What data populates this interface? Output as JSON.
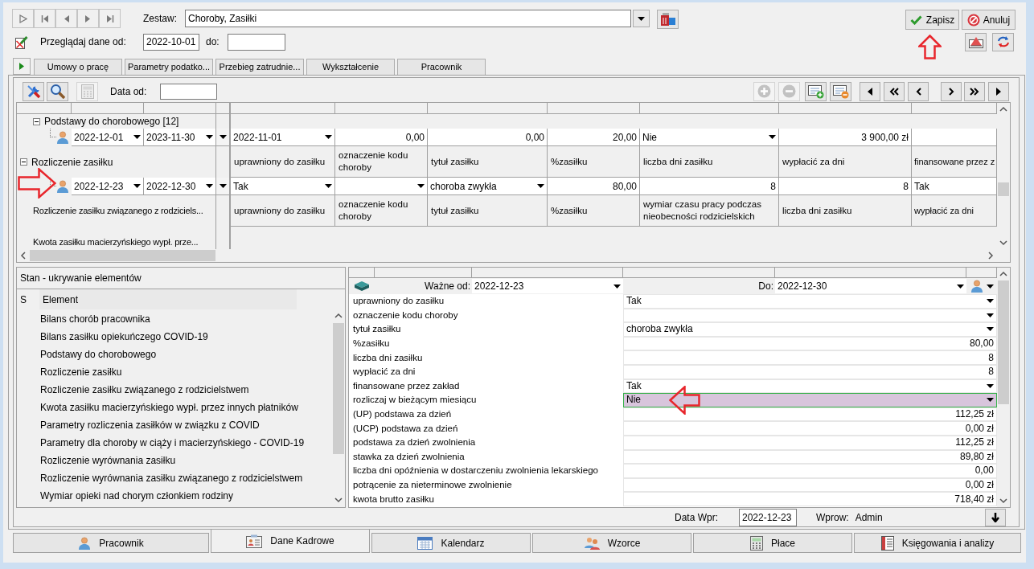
{
  "header": {
    "set_label": "Zestaw:",
    "set_value": "Choroby, Zasiłki",
    "browse_label": "Przeglądaj dane od:",
    "browse_from": "2022-10-01",
    "browse_to_label": "do:",
    "save_button": "Zapisz",
    "cancel_button": "Anuluj"
  },
  "tabs": [
    {
      "label": "Umowy o pracę",
      "selected": false
    },
    {
      "label": "Parametry podatko...",
      "selected": false
    },
    {
      "label": "Przebieg zatrudnie...",
      "selected": false
    },
    {
      "label": "Wykształcenie",
      "selected": false
    },
    {
      "label": "Pracownik",
      "selected": false
    }
  ],
  "grid_toolbar": {
    "date_label": "Data od:",
    "left_tools": [
      {
        "kind": "settings",
        "disabled": false
      },
      {
        "kind": "search",
        "disabled": false
      },
      {
        "kind": "calculator",
        "disabled": true
      }
    ],
    "right_tools": [
      {
        "kind": "add",
        "disabled": true
      },
      {
        "kind": "remove",
        "disabled": true
      },
      {
        "kind": "add-row",
        "disabled": false
      },
      {
        "kind": "remove-row",
        "disabled": false
      }
    ]
  },
  "grid": {
    "groups": [
      {
        "kind": "nested",
        "label": "Podstawy do chorobowego [12]",
        "expanded": true,
        "children": [
          {
            "from": "2022-12-01",
            "to": "2023-11-30",
            "cells": [
              {
                "kind": "select",
                "value": "2022-11-01"
              },
              {
                "kind": "number",
                "value": "0,00"
              },
              {
                "kind": "number",
                "value": "0,00"
              },
              {
                "kind": "number",
                "value": "20,00"
              },
              {
                "kind": "select",
                "value": "Nie"
              },
              {
                "kind": "number",
                "value": "3 900,00 zł"
              },
              {
                "kind": "blank"
              }
            ]
          }
        ]
      },
      {
        "kind": "top",
        "label": "Rozliczenie zasiłku",
        "expanded": true,
        "columns": [
          "uprawniony do zasiłku",
          "oznaczenie kodu choroby",
          "tytuł zasiłku",
          "%zasiłku",
          "liczba dni zasiłku",
          "wypłacić za dni",
          "finansowane przez z"
        ],
        "children": [
          {
            "from": "2022-12-23",
            "to": "2022-12-30",
            "cells": [
              {
                "kind": "select",
                "value": "Tak"
              },
              {
                "kind": "select"
              },
              {
                "kind": "select",
                "value": "choroba zwykła"
              },
              {
                "kind": "number",
                "value": "80,00"
              },
              {
                "kind": "number",
                "value": "8"
              },
              {
                "kind": "number",
                "value": "8"
              },
              {
                "kind": "text",
                "value": "Tak"
              }
            ]
          }
        ]
      },
      {
        "kind": "section",
        "label": "Rozliczenie zasiłku związanego z rodziciels...",
        "columns": [
          "uprawniony do zasiłku",
          "oznaczenie kodu choroby",
          "tytuł zasiłku",
          "%zasiłku",
          "wymiar czasu pracy podczas nieobecności rodzicielskich",
          "liczba dni zasiłku",
          "wypłacić za dni"
        ]
      },
      {
        "kind": "section",
        "label": "Kwota zasiłku macierzyńskiego wypł. prze..."
      }
    ]
  },
  "visibility_panel": {
    "title": "Stan - ukrywanie elementów",
    "columns": [
      "S",
      "Element"
    ],
    "items": [
      "Bilans chorób pracownika",
      "Bilans zasiłku opiekuńczego COVID-19",
      "Podstawy do chorobowego",
      "Rozliczenie zasiłku",
      "Rozliczenie zasiłku związanego z rodzicielstwem",
      "Kwota zasiłku macierzyńskiego wypł. przez innych płatników",
      "Parametry rozliczenia zasiłków w związku z COVID",
      "Parametry dla choroby w ciąży i macierzyńskiego - COVID-19",
      "Rozliczenie wyrównania zasiłku",
      "Rozliczenie wyrównania zasiłku związanego z rodzicielstwem",
      "Wymiar opieki nad chorym członkiem rodziny"
    ]
  },
  "details": {
    "valid_from_label": "Ważne od:",
    "valid_from": "2022-12-23",
    "valid_to_label": "Do:",
    "valid_to": "2022-12-30",
    "rows": [
      {
        "label": "uprawniony do zasiłku",
        "kind": "select",
        "value": "Tak",
        "selected": false
      },
      {
        "label": "oznaczenie kodu choroby",
        "kind": "select",
        "selected": false
      },
      {
        "label": "tytuł zasiłku",
        "kind": "select",
        "value": "choroba zwykła",
        "selected": false
      },
      {
        "label": "%zasiłku",
        "kind": "number",
        "value": "80,00",
        "selected": false
      },
      {
        "label": "liczba dni zasiłku",
        "kind": "number",
        "value": "8",
        "selected": false
      },
      {
        "label": "wypłacić za dni",
        "kind": "number",
        "value": "8",
        "selected": false
      },
      {
        "label": "finansowane przez zakład",
        "kind": "select",
        "value": "Tak",
        "selected": false
      },
      {
        "label": "rozliczaj w bieżącym miesiącu",
        "kind": "select",
        "value": "Nie",
        "selected": true
      },
      {
        "label": "(UP) podstawa za dzień",
        "kind": "number",
        "value": "112,25 zł",
        "selected": false
      },
      {
        "label": "(UCP) podstawa za dzień",
        "kind": "number",
        "value": "0,00 zł",
        "selected": false
      },
      {
        "label": "podstawa za dzień zwolnienia",
        "kind": "number",
        "value": "112,25 zł",
        "selected": false
      },
      {
        "label": "stawka za dzień zwolnienia",
        "kind": "number",
        "value": "89,80 zł",
        "selected": false
      },
      {
        "label": "liczba dni opóźnienia w dostarczeniu zwolnienia lekarskiego",
        "kind": "number",
        "value": "0,00",
        "selected": false
      },
      {
        "label": "potrącenie za nieterminowe zwolnienie",
        "kind": "number",
        "value": "0,00 zł",
        "selected": false
      },
      {
        "label": "kwota brutto zasiłku",
        "kind": "number",
        "value": "718,40 zł",
        "selected": false
      }
    ]
  },
  "footer": {
    "entry_date_label": "Data Wpr:",
    "entry_date": "2022-12-23",
    "entered_by_label": "Wprow:",
    "entered_by": "Admin"
  },
  "bottom_tabs": [
    {
      "label": "Pracownik",
      "selected": false
    },
    {
      "label": "Dane Kadrowe",
      "selected": true
    },
    {
      "label": "Kalendarz",
      "selected": false
    },
    {
      "label": "Wzorce",
      "selected": false
    },
    {
      "label": "Płace",
      "selected": false
    },
    {
      "label": "Księgowania i analizy",
      "selected": false
    }
  ]
}
